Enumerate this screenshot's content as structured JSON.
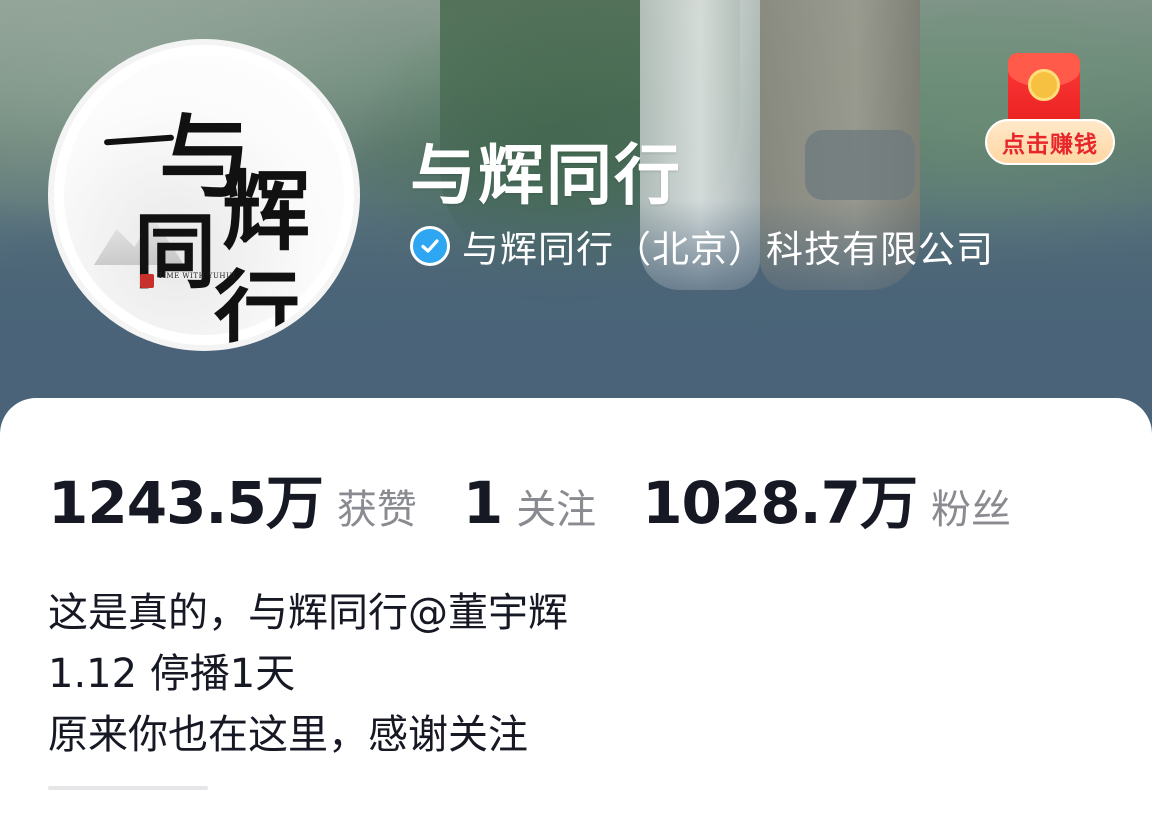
{
  "profile": {
    "name": "与辉同行",
    "verified_label": "与辉同行（北京）科技有限公司",
    "avatar_text": [
      "与",
      "辉",
      "同",
      "行"
    ],
    "avatar_tagline": "TIME WITH YUHUI"
  },
  "promo": {
    "label": "点击赚钱",
    "icon": "red-envelope-icon"
  },
  "stats": [
    {
      "value": "1243.5万",
      "label": "获赞"
    },
    {
      "value": "1",
      "label": "关注"
    },
    {
      "value": "1028.7万",
      "label": "粉丝"
    }
  ],
  "bio": [
    "这是真的，与辉同行@董宇辉",
    "1.12 停播1天",
    "原来你也在这里，感谢关注"
  ],
  "colors": {
    "verified_badge": "#2ea6f2",
    "promo_text": "#e8262a",
    "stat_number": "#161823",
    "stat_label": "#8a8b91"
  }
}
